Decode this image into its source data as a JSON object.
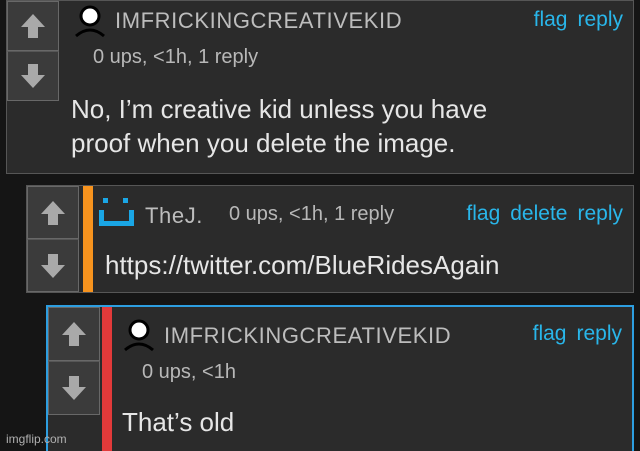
{
  "colors": {
    "link": "#29b6ea",
    "stripe_orange": "#f7931e",
    "stripe_red": "#e23a3a",
    "selected_border": "#2d9ee0",
    "avatar_blue": "#1aa6e5"
  },
  "icons": {
    "upvote": "arrow-up-icon",
    "downvote": "arrow-down-icon",
    "avatar_person": "person-avatar-icon",
    "avatar_face": "smiley-avatar-icon"
  },
  "comments": [
    {
      "username": "IMFRICKINGCREATIVEKID",
      "meta": "0 ups, <1h, 1 reply",
      "actions": {
        "flag": "flag",
        "reply": "reply"
      },
      "text_line1": "No, I’m creative kid unless you have",
      "text_line2": "proof when you delete the image."
    },
    {
      "username": "TheJ.",
      "meta": "0 ups, <1h, 1 reply",
      "actions": {
        "flag": "flag",
        "delete": "delete",
        "reply": "reply"
      },
      "text_line1": "https://twitter.com/BlueRidesAgain"
    },
    {
      "username": "IMFRICKINGCREATIVEKID",
      "meta": "0 ups, <1h",
      "actions": {
        "flag": "flag",
        "reply": "reply"
      },
      "text_line1": "That’s old"
    }
  ],
  "watermark": "imgflip.com"
}
